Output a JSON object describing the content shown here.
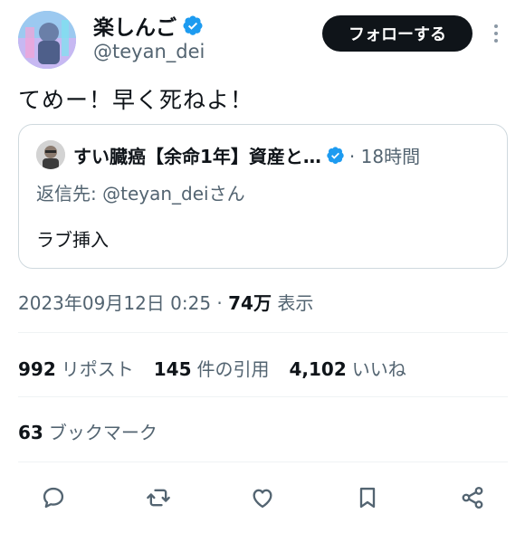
{
  "author": {
    "display_name": "楽しんご",
    "handle": "@teyan_dei",
    "verified": true
  },
  "follow_button_label": "フォローする",
  "tweet": {
    "text": "てめー！早く死ねよ！"
  },
  "quote": {
    "display_name": "すい臓癌【余命1年】資産と…",
    "verified": true,
    "time": "· 18時間",
    "reply_prefix": "返信先: ",
    "reply_mention": "@teyan_dei",
    "reply_suffix": "さん",
    "body": "ラブ挿入"
  },
  "meta": {
    "datetime": "2023年09月12日 0:25 · ",
    "views_count": "74万",
    "views_label": " 表示"
  },
  "stats": [
    {
      "num": "992",
      "label": "リポスト"
    },
    {
      "num": "145",
      "label": "件の引用"
    },
    {
      "num": "4,102",
      "label": "いいね"
    }
  ],
  "bookmarks": {
    "num": "63",
    "label": "ブックマーク"
  },
  "colors": {
    "text": "#0f1419",
    "secondary": "#536471",
    "verified": "#1d9bf0",
    "border": "#cfd9de",
    "follow_bg": "#0f1419"
  },
  "action_icons": [
    "reply-icon",
    "repost-icon",
    "like-icon",
    "bookmark-icon",
    "share-icon"
  ]
}
